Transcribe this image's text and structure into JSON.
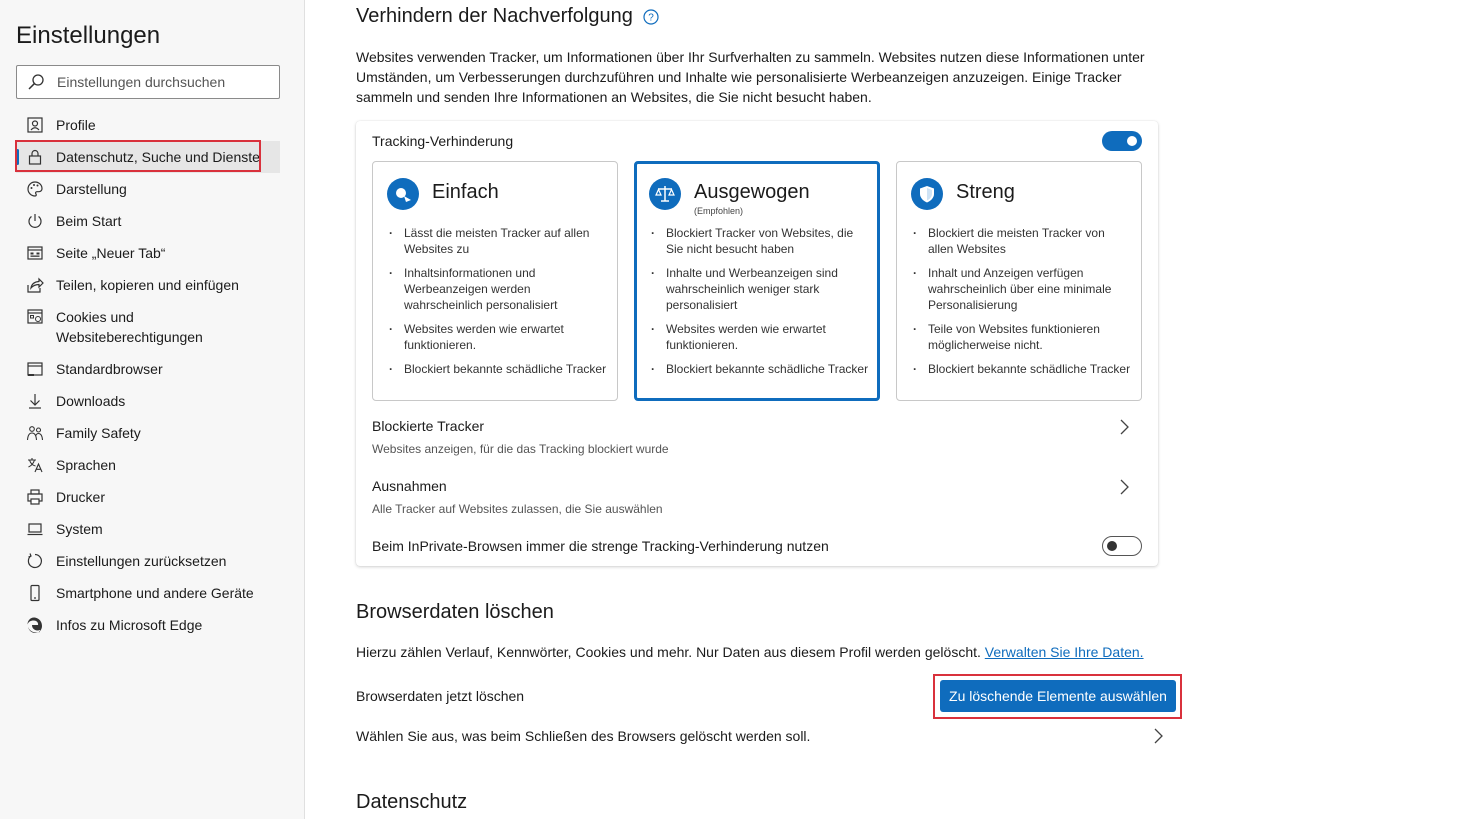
{
  "sidebar": {
    "title": "Einstellungen",
    "search_placeholder": "Einstellungen durchsuchen",
    "items": [
      {
        "label": "Profile",
        "icon": "profile-icon"
      },
      {
        "label": "Datenschutz, Suche und Dienste",
        "icon": "lock-icon",
        "active": true
      },
      {
        "label": "Darstellung",
        "icon": "palette-icon"
      },
      {
        "label": "Beim Start",
        "icon": "power-icon"
      },
      {
        "label": "Seite „Neuer Tab“",
        "icon": "newtab-icon"
      },
      {
        "label": "Teilen, kopieren und einfügen",
        "icon": "share-icon"
      },
      {
        "label": "Cookies und Websiteberechtigungen",
        "icon": "cookies-icon"
      },
      {
        "label": "Standardbrowser",
        "icon": "browser-icon"
      },
      {
        "label": "Downloads",
        "icon": "download-icon"
      },
      {
        "label": "Family Safety",
        "icon": "family-icon"
      },
      {
        "label": "Sprachen",
        "icon": "language-icon"
      },
      {
        "label": "Drucker",
        "icon": "printer-icon"
      },
      {
        "label": "System",
        "icon": "system-icon"
      },
      {
        "label": "Einstellungen zurücksetzen",
        "icon": "reset-icon"
      },
      {
        "label": "Smartphone und andere Geräte",
        "icon": "phone-icon"
      },
      {
        "label": "Infos zu Microsoft Edge",
        "icon": "edge-icon"
      }
    ]
  },
  "tracking": {
    "heading": "Verhindern der Nachverfolgung",
    "description": "Websites verwenden Tracker, um Informationen über Ihr Surfverhalten zu sammeln. Websites nutzen diese Informationen unter Umständen, um Verbesserungen durchzuführen und Inhalte wie personalisierte Werbeanzeigen anzuzeigen. Einige Tracker sammeln und senden Ihre Informationen an Websites, die Sie nicht besucht haben.",
    "toggle_label": "Tracking-Verhinderung",
    "toggle_on": true,
    "levels": [
      {
        "title": "Einfach",
        "subtitle": "",
        "icon": "basic-icon",
        "bullets": [
          "Lässt die meisten Tracker auf allen Websites zu",
          "Inhaltsinformationen und Werbeanzeigen werden wahrscheinlich personalisiert",
          "Websites werden wie erwartet funktionieren.",
          "Blockiert bekannte schädliche Tracker"
        ]
      },
      {
        "title": "Ausgewogen",
        "subtitle": "(Empfohlen)",
        "icon": "balance-scale-icon",
        "selected": true,
        "bullets": [
          "Blockiert Tracker von Websites, die Sie nicht besucht haben",
          "Inhalte und Werbeanzeigen sind wahrscheinlich weniger stark personalisiert",
          "Websites werden wie erwartet funktionieren.",
          "Blockiert bekannte schädliche Tracker"
        ]
      },
      {
        "title": "Streng",
        "subtitle": "",
        "icon": "shield-icon",
        "bullets": [
          "Blockiert die meisten Tracker von allen Websites",
          "Inhalt und Anzeigen verfügen wahrscheinlich über eine minimale Personalisierung",
          "Teile von Websites funktionieren möglicherweise nicht.",
          "Blockiert bekannte schädliche Tracker"
        ]
      }
    ],
    "blocked_title": "Blockierte Tracker",
    "blocked_sub": "Websites anzeigen, für die das Tracking blockiert wurde",
    "exceptions_title": "Ausnahmen",
    "exceptions_sub": "Alle Tracker auf Websites zulassen, die Sie auswählen",
    "inprivate_label": "Beim InPrivate-Browsen immer die strenge Tracking-Verhinderung nutzen",
    "inprivate_on": false
  },
  "clear": {
    "heading": "Browserdaten löschen",
    "description": "Hierzu zählen Verlauf, Kennwörter, Cookies und mehr. Nur Daten aus diesem Profil werden gelöscht.",
    "link": "Verwalten Sie Ihre Daten.",
    "now_label": "Browserdaten jetzt löschen",
    "button": "Zu löschende Elemente auswählen",
    "on_close_label": "Wählen Sie aus, was beim Schließen des Browsers gelöscht werden soll."
  },
  "privacy": {
    "heading": "Datenschutz"
  },
  "colors": {
    "accent": "#0f6cbd",
    "highlight": "#d9313c"
  }
}
